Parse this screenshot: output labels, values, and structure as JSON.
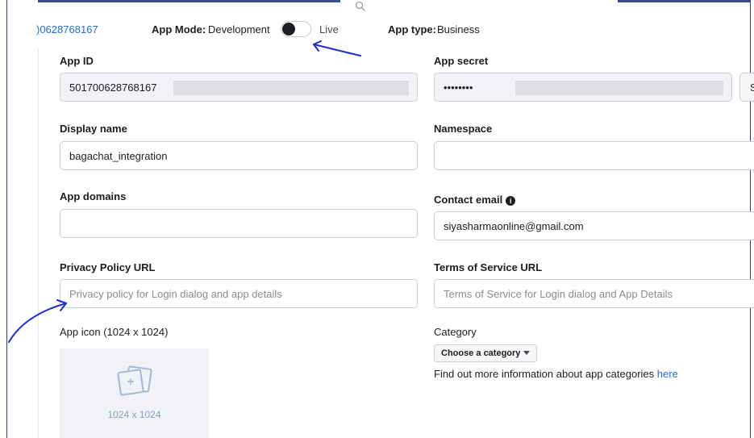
{
  "header": {
    "app_id_link": ")0628768167",
    "app_mode_label": "App Mode:",
    "app_mode_value": "Development",
    "live_label": "Live",
    "app_type_label": "App type:",
    "app_type_value": "Business"
  },
  "fields": {
    "app_id": {
      "label": "App ID",
      "value": "501700628768167"
    },
    "app_secret": {
      "label": "App secret",
      "value": "••••••••",
      "show_button": "S"
    },
    "display_name": {
      "label": "Display name",
      "value": "bagachat_integration"
    },
    "namespace": {
      "label": "Namespace",
      "value": ""
    },
    "app_domains": {
      "label": "App domains",
      "value": ""
    },
    "contact_email": {
      "label": "Contact email",
      "value": "siyasharmaonline@gmail.com"
    },
    "privacy_policy_url": {
      "label": "Privacy Policy URL",
      "placeholder": "Privacy policy for Login dialog and app details"
    },
    "terms_of_service_url": {
      "label": "Terms of Service URL",
      "placeholder": "Terms of Service for Login dialog and App Details"
    }
  },
  "app_icon": {
    "label": "App icon (1024 x 1024)",
    "size_text": "1024 x 1024"
  },
  "category": {
    "label": "Category",
    "button_label": "Choose a category",
    "help_text": "Find out more information about app categories ",
    "help_link": "here"
  },
  "colors": {
    "link": "#216fdb",
    "annotation": "#1b2fd6",
    "frame": "#2b3f8f"
  },
  "icons": [
    "search-icon",
    "info-icon",
    "image-icon",
    "caret-down-icon"
  ]
}
